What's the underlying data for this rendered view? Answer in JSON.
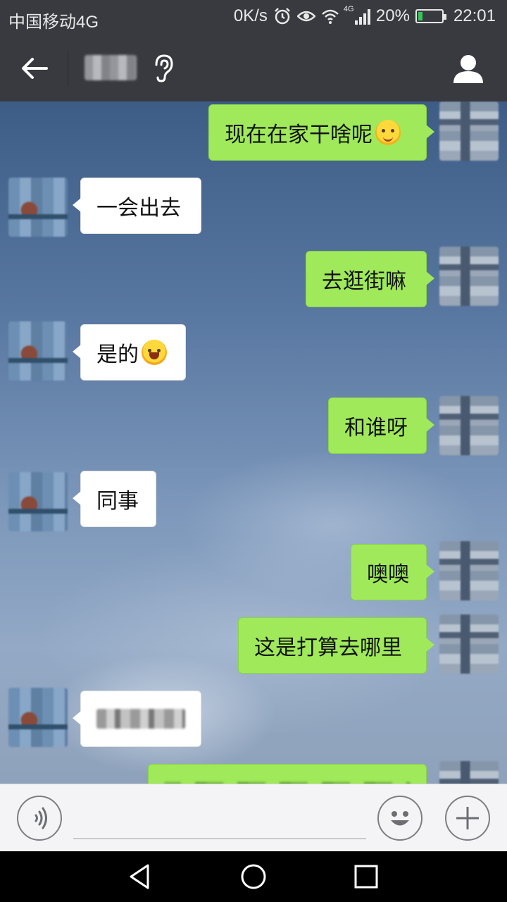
{
  "status_bar": {
    "carrier": "中国移动4G",
    "net_speed": "0K/s",
    "signal_label": "4G",
    "battery_percent": "20%",
    "battery_level": 0.2,
    "time": "22:01",
    "icons": [
      "alarm-icon",
      "eye-icon",
      "wifi-icon",
      "signal-icon",
      "battery-icon"
    ]
  },
  "title_bar": {
    "back_icon": "arrow-left-icon",
    "ear_icon": "ear-icon",
    "profile_icon": "person-icon"
  },
  "messages": [
    {
      "side": "out",
      "text": "现在在家干啥呢",
      "emoji": "blush-emoji"
    },
    {
      "side": "in",
      "text": "一会出去"
    },
    {
      "side": "out",
      "text": "去逛街嘛"
    },
    {
      "side": "in",
      "text": "是的",
      "emoji": "laugh-cry-emoji"
    },
    {
      "side": "out",
      "text": "和谁呀"
    },
    {
      "side": "in",
      "text": "同事"
    },
    {
      "side": "out",
      "text": "噢噢"
    },
    {
      "side": "out",
      "text": "这是打算去哪里"
    },
    {
      "side": "in",
      "text": ""
    },
    {
      "side": "out",
      "text": ""
    }
  ],
  "input_bar": {
    "voice_icon": "voice-icon",
    "emoji_icon": "smiley-icon",
    "plus_icon": "plus-icon"
  },
  "nav_bar": {
    "icons": [
      "nav-back-icon",
      "nav-home-icon",
      "nav-recents-icon"
    ]
  },
  "colors": {
    "header_bg": "#393a3f",
    "outgoing_bubble": "#9fe95a",
    "incoming_bubble": "#ffffff",
    "input_bar_bg": "#f4f4f6"
  }
}
